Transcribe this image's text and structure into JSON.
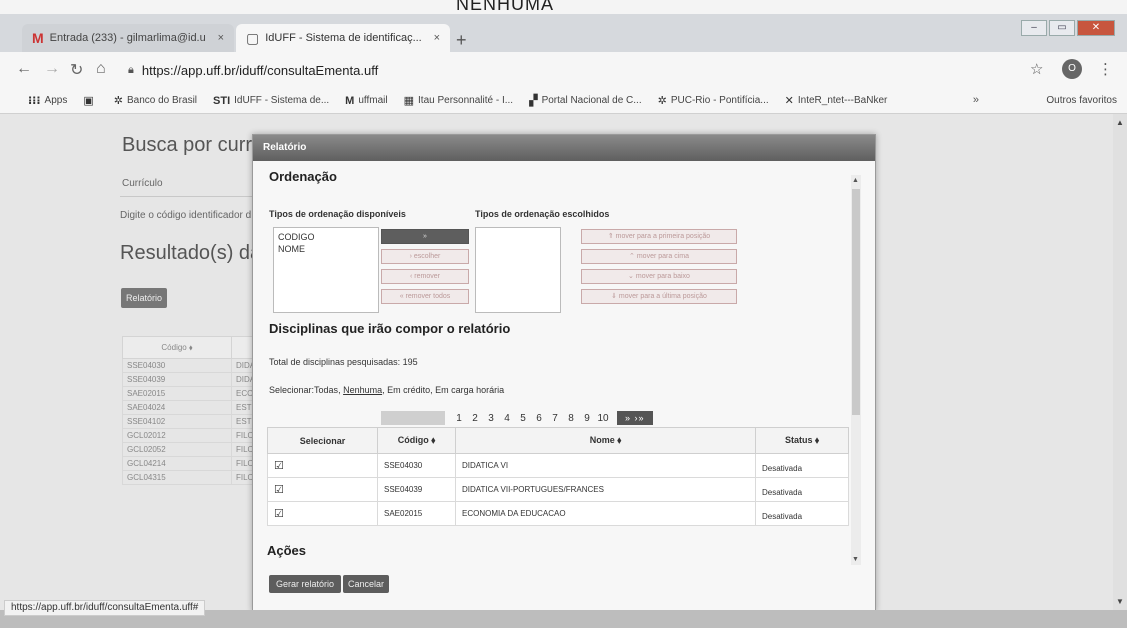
{
  "photo_caption": "NENHUMA",
  "browser": {
    "tabs": [
      {
        "icon": "M",
        "label": "Entrada (233) - gilmarlima@id.u",
        "close": "×"
      },
      {
        "icon": "▢",
        "label": "IdUFF - Sistema de identificaç...",
        "close": "×"
      }
    ],
    "new_tab": "+",
    "window_controls": {
      "minimize": "–",
      "maximize": "▭",
      "close": "✕"
    },
    "url": "https://app.uff.br/iduff/consultaEmenta.uff",
    "profile_initial": "O",
    "bookmarks": [
      {
        "icon": "⁝⁝⁝",
        "label": "Apps"
      },
      {
        "icon": "▣",
        "label": ""
      },
      {
        "icon": "✲",
        "label": "Banco do Brasil"
      },
      {
        "icon": "STI",
        "label": "IdUFF - Sistema de..."
      },
      {
        "icon": "M",
        "label": "uffmail"
      },
      {
        "icon": "▦",
        "label": "Itau Personnalité - I..."
      },
      {
        "icon": "▞",
        "label": "Portal Nacional de C..."
      },
      {
        "icon": "✲",
        "label": "PUC-Rio - Pontifícia..."
      },
      {
        "icon": "✕",
        "label": "InteR_ntet---BaNker"
      }
    ],
    "bookmarks_more": "»",
    "other_bookmarks": "Outros favoritos",
    "status_url": "https://app.uff.br/iduff/consultaEmenta.uff#"
  },
  "page": {
    "title": "Busca por curric",
    "curriculo_label": "Currículo",
    "hint": "Digite o código identificador d",
    "result_title": "Resultado(s) da",
    "report_button": "Relatório",
    "bg_table": {
      "header": "Código ⬧",
      "rows": [
        [
          "SSE04030",
          "DIDA"
        ],
        [
          "SSE04039",
          "DIDA"
        ],
        [
          "SAE02015",
          "ECO"
        ],
        [
          "SAE04024",
          "ESTF"
        ],
        [
          "SSE04102",
          "ESTF"
        ],
        [
          "GCL02012",
          "FILO"
        ],
        [
          "GCL02052",
          "FILO"
        ],
        [
          "GCL04214",
          "FILO"
        ],
        [
          "GCL04315",
          "FILO"
        ]
      ]
    }
  },
  "dialog": {
    "title": "Relatório",
    "ordenacao_title": "Ordenação",
    "available_label": "Tipos de ordenação disponíveis",
    "chosen_label": "Tipos de ordenação escolhidos",
    "available_options": [
      "CODIGO",
      "NOME"
    ],
    "move_buttons": [
      "»",
      "› escolher",
      "‹ remover",
      "« remover todos"
    ],
    "order_buttons": [
      "⇑ mover para a primeira posição",
      "⌃ mover para cima",
      "⌄ mover para baixo",
      "⇓ mover para a última posição"
    ],
    "disciplinas_title": "Disciplinas que irão compor o relatório",
    "total_text": "Total de disciplinas pesquisadas: 195",
    "select_prefix": "Selecionar:",
    "select_links": [
      "Todas",
      "Nenhuma",
      "Em crédito",
      "Em carga horária"
    ],
    "pager": {
      "pages": [
        "1",
        "2",
        "3",
        "4",
        "5",
        "6",
        "7",
        "8",
        "9",
        "10"
      ],
      "next": "» ›»"
    },
    "table": {
      "headers": [
        "Selecionar",
        "Código ⬧",
        "Nome ⬧",
        "Status ⬧"
      ],
      "rows": [
        {
          "check": "☑",
          "codigo": "SSE04030",
          "nome": "DIDATICA VI",
          "status": "Desativada"
        },
        {
          "check": "☑",
          "codigo": "SSE04039",
          "nome": "DIDATICA VII-PORTUGUES/FRANCES",
          "status": "Desativada"
        },
        {
          "check": "☑",
          "codigo": "SAE02015",
          "nome": "ECONOMIA DA EDUCACAO",
          "status": "Desativada"
        }
      ]
    },
    "acoes_title": "Ações",
    "gerar_button": "Gerar relatório",
    "cancelar_button": "Cancelar"
  }
}
